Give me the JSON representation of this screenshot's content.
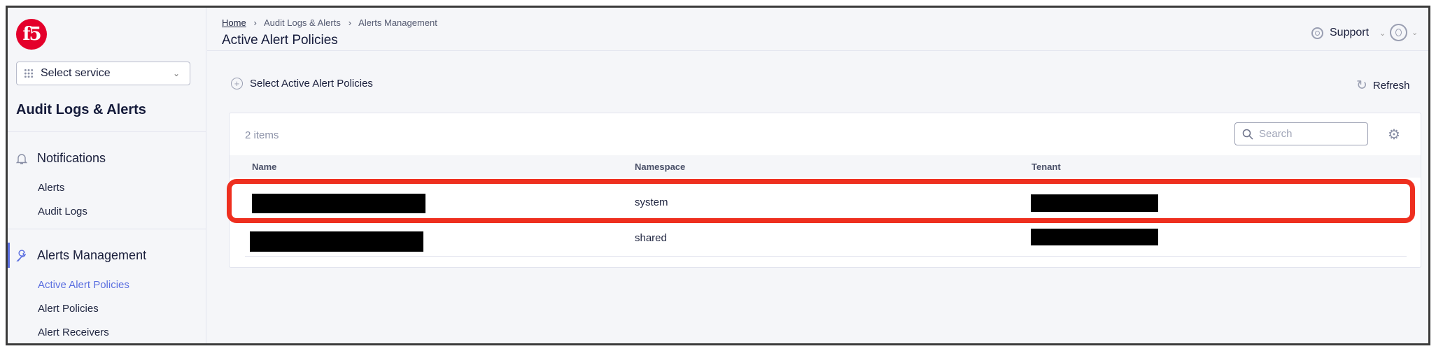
{
  "sidebar": {
    "logo_text": "f5",
    "select_service": "Select service",
    "section_title": "Audit Logs & Alerts",
    "groups": [
      {
        "label": "Notifications",
        "icon": "bell-icon",
        "items": [
          "Alerts",
          "Audit Logs"
        ]
      },
      {
        "label": "Alerts Management",
        "icon": "wrench-icon",
        "items": [
          "Active Alert Policies",
          "Alert Policies",
          "Alert Receivers"
        ],
        "active_item": "Active Alert Policies"
      }
    ]
  },
  "header": {
    "breadcrumb": [
      "Home",
      "Audit Logs & Alerts",
      "Alerts Management"
    ],
    "title": "Active Alert Policies",
    "support_label": "Support"
  },
  "toolbar": {
    "select_label": "Select Active Alert Policies",
    "refresh_label": "Refresh"
  },
  "table": {
    "count": "2 items",
    "search_placeholder": "Search",
    "columns": [
      "Name",
      "Namespace",
      "Tenant"
    ],
    "rows": [
      {
        "namespace": "system"
      },
      {
        "namespace": "shared"
      }
    ]
  },
  "colors": {
    "accent": "#5b6fe0",
    "highlight": "#ee2f1f",
    "brand": "#e4002b"
  }
}
